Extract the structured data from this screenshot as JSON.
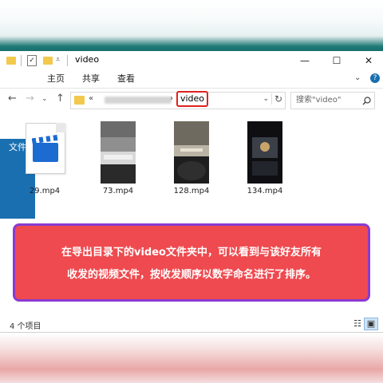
{
  "window": {
    "title": "video",
    "minimize_glyph": "—",
    "maximize_glyph": "☐",
    "close_glyph": "✕"
  },
  "ribbon": {
    "tabs": [
      "文件",
      "主页",
      "共享",
      "查看"
    ],
    "expand_glyph": "⌄",
    "help_glyph": "?"
  },
  "navigation": {
    "back_glyph": "←",
    "forward_glyph": "→",
    "recent_glyph": "⌄",
    "up_glyph": "↑",
    "path_prefix": "«",
    "path_separator": "›",
    "current_folder": "video",
    "dropdown_glyph": "⌄",
    "refresh_glyph": "↻"
  },
  "search": {
    "placeholder": "搜索\"video\"",
    "icon": "search-icon"
  },
  "files": [
    {
      "name": "29.mp4",
      "thumbnail": "video-file-icon"
    },
    {
      "name": "73.mp4",
      "thumbnail": "video-frame"
    },
    {
      "name": "128.mp4",
      "thumbnail": "video-frame"
    },
    {
      "name": "134.mp4",
      "thumbnail": "video-frame"
    }
  ],
  "banner": {
    "line1": "在导出目录下的video文件夹中，可以看到与该好友所有",
    "line2": "收发的视频文件，按收发顺序以数字命名进行了排序。"
  },
  "status": {
    "item_count": "4 个项目",
    "details_view_glyph": "☷",
    "icons_view_glyph": "▣"
  },
  "colors": {
    "accent": "#1a6fb0",
    "highlight_border": "#e02121",
    "banner_fill": "#ee4a4f",
    "banner_border": "#8a3bd0"
  }
}
